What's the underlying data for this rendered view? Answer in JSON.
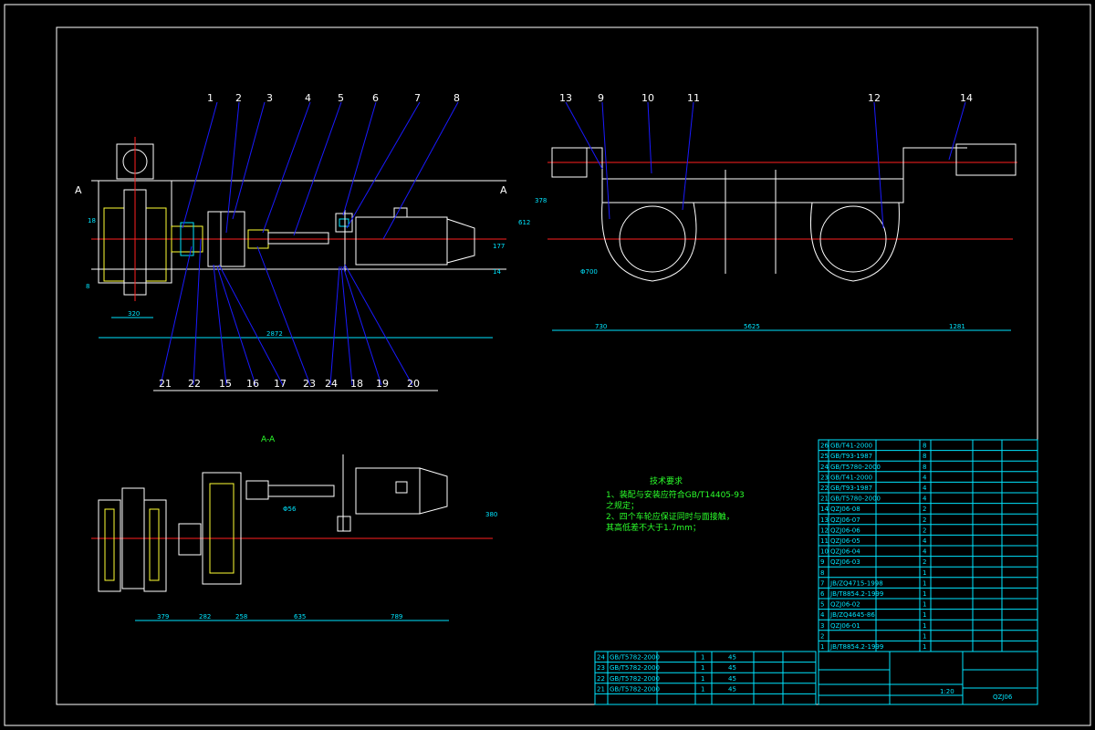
{
  "balloons_top": [
    "1",
    "2",
    "3",
    "4",
    "5",
    "6",
    "7",
    "8"
  ],
  "balloons_bottom": [
    "21",
    "22",
    "15",
    "16",
    "17",
    "23",
    "24",
    "18",
    "19",
    "20"
  ],
  "balloons_right_top": [
    "13",
    "9",
    "10",
    "11",
    "12",
    "14"
  ],
  "section_marks": {
    "a_left": "A",
    "a_right": "A",
    "section_title": "A-A"
  },
  "dims_left": {
    "total": "2872",
    "inner": "320",
    "h1": "18",
    "h2": "177",
    "h3": "14",
    "side": "8"
  },
  "dims_right": {
    "d1": "730",
    "d2": "5625",
    "d3": "1281",
    "v1": "378",
    "v2": "612",
    "dia": "Φ700"
  },
  "dims_bottom": {
    "d1": "379",
    "d2": "282",
    "d3": "258",
    "d4": "635",
    "d5": "789",
    "v": "380",
    "w": "Φ56"
  },
  "tech": {
    "title": "技术要求",
    "line1": "1、装配与安装应符合GB/T14405-93",
    "line2": "之规定；",
    "line3": "2、四个车轮应保证同时与面接触，",
    "line4": "其高低差不大于1.7mm；"
  },
  "parts_upper": [
    {
      "no": "26",
      "code": "GB/T41-2000",
      "qty": "8"
    },
    {
      "no": "25",
      "code": "GB/T93-1987",
      "qty": "8"
    },
    {
      "no": "24",
      "code": "GB/T5780-2000",
      "qty": "8"
    },
    {
      "no": "23",
      "code": "GB/T41-2000",
      "qty": "4"
    },
    {
      "no": "22",
      "code": "GB/T93-1987",
      "qty": "4"
    },
    {
      "no": "21",
      "code": "GB/T5780-2000",
      "qty": "4"
    },
    {
      "no": "14",
      "code": "QZJ06-08",
      "qty": "2"
    },
    {
      "no": "13",
      "code": "QZJ06-07",
      "qty": "2"
    },
    {
      "no": "12",
      "code": "QZJ06-06",
      "qty": "2"
    },
    {
      "no": "11",
      "code": "QZJ06-05",
      "qty": "4"
    },
    {
      "no": "10",
      "code": "QZJ06-04",
      "qty": "4"
    },
    {
      "no": "9",
      "code": "QZJ06-03",
      "qty": "2"
    },
    {
      "no": "8",
      "code": "",
      "qty": "1"
    },
    {
      "no": "7",
      "code": "JB/ZQ4715-1998",
      "qty": "1"
    },
    {
      "no": "6",
      "code": "JB/T8854.2-1999",
      "qty": "1"
    },
    {
      "no": "5",
      "code": "QZJ06-02",
      "qty": "1"
    },
    {
      "no": "4",
      "code": "JB/ZQ4645-86",
      "qty": "1"
    },
    {
      "no": "3",
      "code": "QZJ06-01",
      "qty": "1"
    },
    {
      "no": "2",
      "code": "",
      "qty": "1"
    },
    {
      "no": "1",
      "code": "JB/T8854.2-1999",
      "qty": "1"
    }
  ],
  "parts_lower": [
    {
      "no": "24",
      "code": "GB/T5782-2000",
      "qty": "1",
      "mat": "45"
    },
    {
      "no": "23",
      "code": "GB/T5782-2000",
      "qty": "1",
      "mat": "45"
    },
    {
      "no": "22",
      "code": "GB/T5782-2000",
      "qty": "1",
      "mat": "45"
    },
    {
      "no": "21",
      "code": "GB/T5782-2000",
      "qty": "1",
      "mat": "45"
    }
  ],
  "titleblock": {
    "drawing_no": "QZJ06",
    "scale": "1:20"
  }
}
